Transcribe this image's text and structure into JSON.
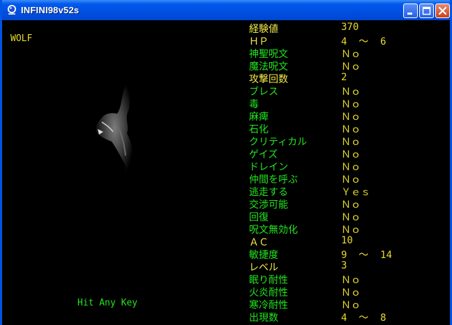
{
  "window": {
    "title": "INFINI98v52s"
  },
  "monster": {
    "name": "WOLF"
  },
  "prompt": "Hit Any Key",
  "stats": [
    {
      "label": "経験値",
      "value": "370"
    },
    {
      "label": "ＨＰ",
      "value": "4  ～  6"
    },
    {
      "label": "神聖呪文",
      "value": "Ｎｏ"
    },
    {
      "label": "魔法呪文",
      "value": "Ｎｏ"
    },
    {
      "label": "攻撃回数",
      "value": "2"
    },
    {
      "label": "ブレス",
      "value": "Ｎｏ"
    },
    {
      "label": "毒",
      "value": "Ｎｏ"
    },
    {
      "label": "麻痺",
      "value": "Ｎｏ"
    },
    {
      "label": "石化",
      "value": "Ｎｏ"
    },
    {
      "label": "クリティカル",
      "value": "Ｎｏ"
    },
    {
      "label": "ゲイズ",
      "value": "Ｎｏ"
    },
    {
      "label": "ドレイン",
      "value": "Ｎｏ"
    },
    {
      "label": "仲間を呼ぶ",
      "value": "Ｎｏ"
    },
    {
      "label": "逃走する",
      "value": "Ｙｅｓ"
    },
    {
      "label": "交渉可能",
      "value": "Ｎｏ"
    },
    {
      "label": "回復",
      "value": "Ｎｏ"
    },
    {
      "label": "呪文無効化",
      "value": "Ｎｏ"
    },
    {
      "label": "ＡＣ",
      "value": "10"
    },
    {
      "label": "敏捷度",
      "value": "9  ～  14"
    },
    {
      "label": "レベル",
      "value": "3"
    },
    {
      "label": "眠り耐性",
      "value": "Ｎｏ"
    },
    {
      "label": "火炎耐性",
      "value": "Ｎｏ"
    },
    {
      "label": "寒冷耐性",
      "value": "Ｎｏ"
    },
    {
      "label": "出現数",
      "value": "4  ～  8"
    }
  ],
  "highlight_labels": [
    "経験値",
    "ＨＰ",
    "攻撃回数",
    "ＡＣ",
    "レベル"
  ]
}
